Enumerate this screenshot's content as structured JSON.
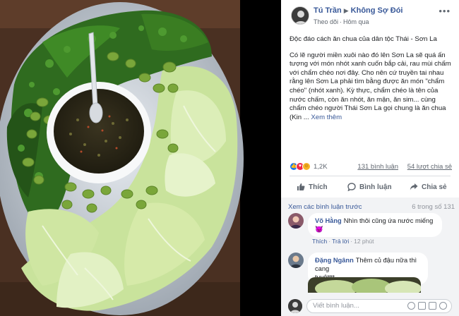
{
  "post": {
    "author": "Tú Trần",
    "arrow": "▶",
    "group": "Không Sợ Đói",
    "follow": "Theo dõi",
    "time": "Hôm qua",
    "more": "•••",
    "headline": "Độc đáo cách ăn chua của dân tộc Thái - Sơn La",
    "body": "Có lẽ người miền xuôi nào đó lên Sơn La sẽ quá ấn tượng với món nhót xanh cuốn bắp cải, rau mùi chấm với chẩm chéo nơi đây. Cho nên cứ truyền tai nhau rằng lên Sơn La phải tìm bằng được ăn món \"chẩm chéo\" (nhót xanh). Kỳ thực, chẩm chéo là tên của nước chấm, còn ăn nhót, ăn mận, ăn sim... cùng chẩm chéo người Thái Sơn La gọi chung là ăn chua (Kin ...",
    "see_more": "Xem thêm"
  },
  "stats": {
    "reactions": "1,2K",
    "comments": "131 bình luận",
    "shares": "54 lượt chia sẻ"
  },
  "actions": {
    "like": "Thích",
    "comment": "Bình luận",
    "share": "Chia sẻ"
  },
  "comments": {
    "view_previous": "Xem các bình luận trước",
    "count_of": "6 trong số 131",
    "items": [
      {
        "name": "Võ Hằng",
        "text": "Nhìn thôi cũng ứa nước miếng 😈",
        "like": "Thích",
        "reply": "Trả lời",
        "time": "12 phút"
      },
      {
        "name": "Đặng Ngânn",
        "text_line1": "Thêm củ đậu nữa thì cang",
        "text_line2": "tuyệtttt"
      }
    ],
    "write_placeholder": "Viết bình luận..."
  },
  "colors": {
    "link": "#385898",
    "like_blue": "#1877f2",
    "love_red": "#f02849"
  }
}
